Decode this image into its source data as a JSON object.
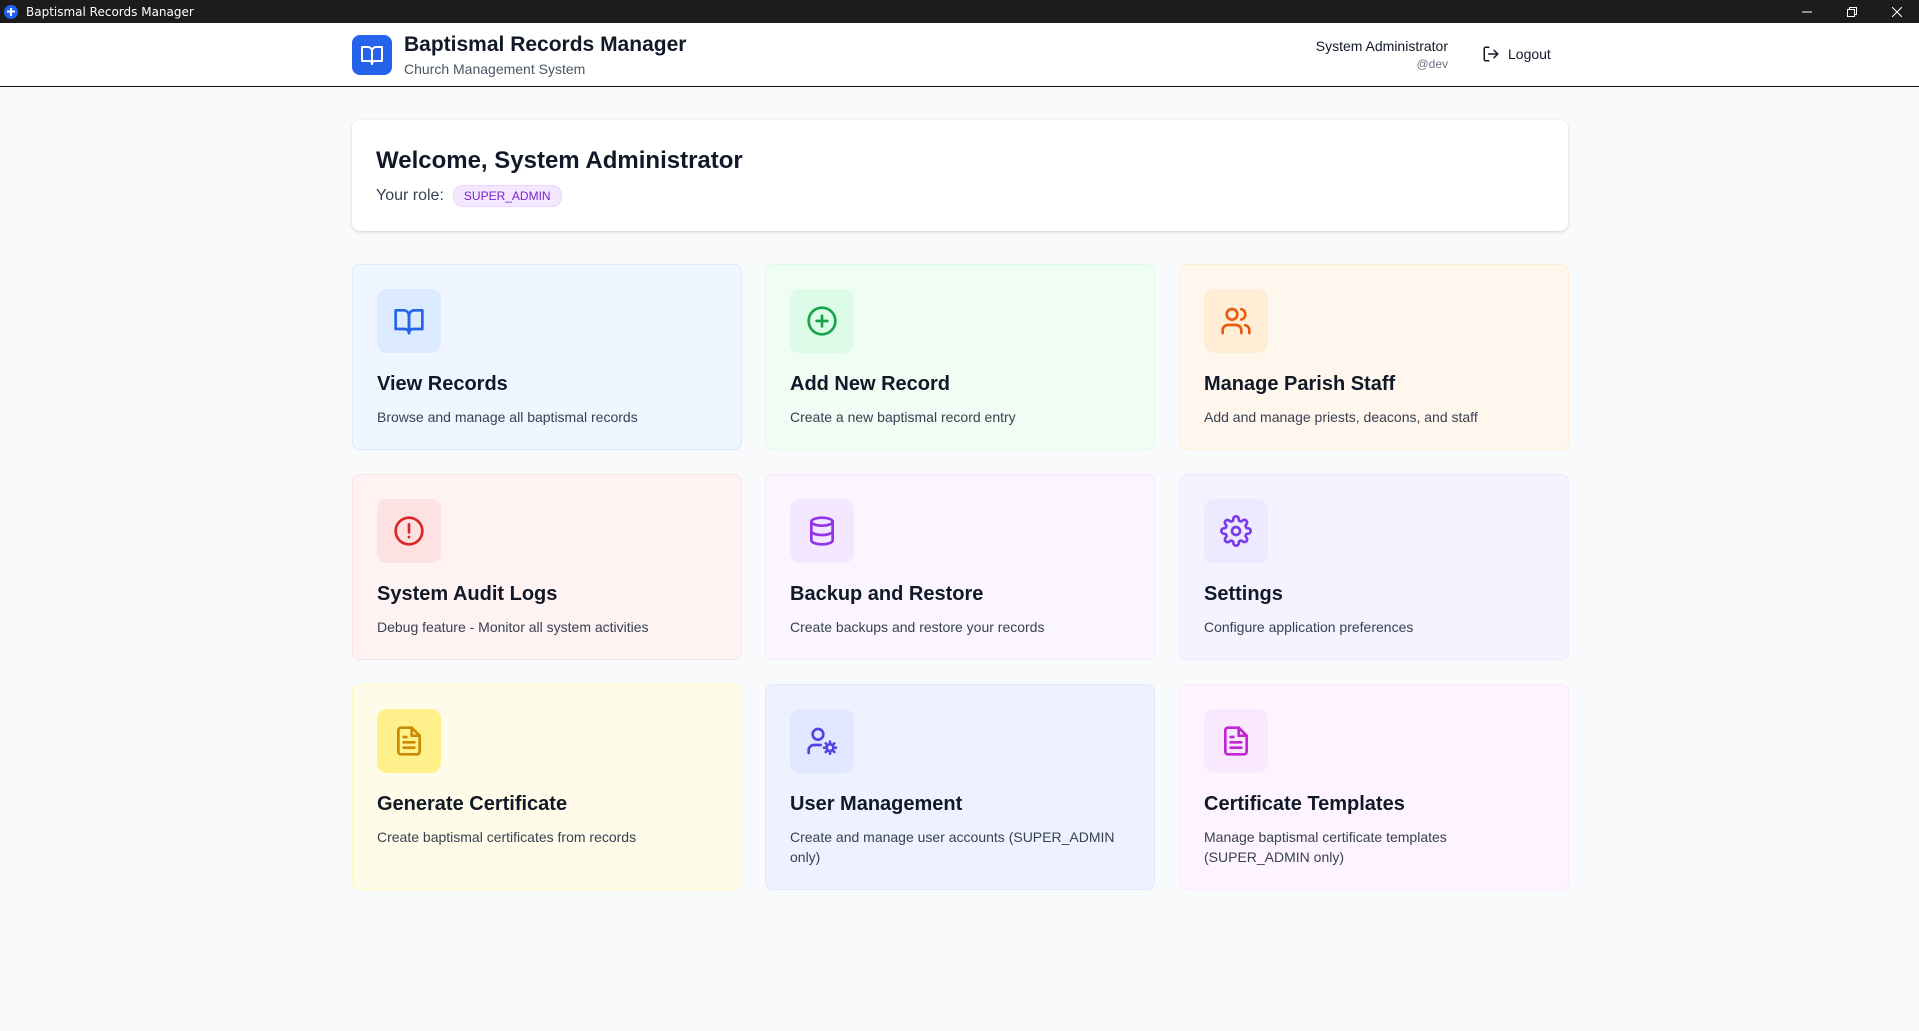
{
  "window": {
    "title": "Baptismal Records Manager"
  },
  "header": {
    "title": "Baptismal Records Manager",
    "subtitle": "Church Management System",
    "user_name": "System Administrator",
    "user_handle": "@dev",
    "logout_label": "Logout"
  },
  "welcome": {
    "heading": "Welcome, System Administrator",
    "role_label": "Your role:",
    "role_value": "SUPER_ADMIN"
  },
  "tiles": [
    {
      "title": "View Records",
      "description": "Browse and manage all baptismal records",
      "icon": "book-open-icon",
      "bg": "#eff6ff",
      "border": "#dbeafe",
      "icon_bg": "#dbeafe",
      "icon_color": "#2563eb"
    },
    {
      "title": "Add New Record",
      "description": "Create a new baptismal record entry",
      "icon": "plus-circle-icon",
      "bg": "#f0fdf4",
      "border": "#dcfce7",
      "icon_bg": "#dcfce7",
      "icon_color": "#16a34a"
    },
    {
      "title": "Manage Parish Staff",
      "description": "Add and manage priests, deacons, and staff",
      "icon": "users-icon",
      "bg": "#fff7ed",
      "border": "#ffedd5",
      "icon_bg": "#ffedd5",
      "icon_color": "#ea580c"
    },
    {
      "title": "System Audit Logs",
      "description": "Debug feature - Monitor all system activities",
      "icon": "alert-circle-icon",
      "bg": "#fef2f2",
      "border": "#fee2e2",
      "icon_bg": "#fee2e2",
      "icon_color": "#dc2626"
    },
    {
      "title": "Backup and Restore",
      "description": "Create backups and restore your records",
      "icon": "database-icon",
      "bg": "#faf5ff",
      "border": "#f3e8ff",
      "icon_bg": "#f3e8ff",
      "icon_color": "#9333ea"
    },
    {
      "title": "Settings",
      "description": "Configure application preferences",
      "icon": "gear-icon",
      "bg": "#f5f3ff",
      "border": "#ede9fe",
      "icon_bg": "#ede9fe",
      "icon_color": "#7c3aed"
    },
    {
      "title": "Generate Certificate",
      "description": "Create baptismal certificates from records",
      "icon": "file-text-icon",
      "bg": "#fefce8",
      "border": "#fef9c3",
      "icon_bg": "#fef08a",
      "icon_color": "#ca8a04"
    },
    {
      "title": "User Management",
      "description": "Create and manage user accounts (SUPER_ADMIN only)",
      "icon": "user-cog-icon",
      "bg": "#eef2ff",
      "border": "#e0e7ff",
      "icon_bg": "#e0e7ff",
      "icon_color": "#4f46e5"
    },
    {
      "title": "Certificate Templates",
      "description": "Manage baptismal certificate templates (SUPER_ADMIN only)",
      "icon": "file-text-icon",
      "bg": "#fdf4ff",
      "border": "#fae8ff",
      "icon_bg": "#fae8ff",
      "icon_color": "#c026d3"
    }
  ]
}
